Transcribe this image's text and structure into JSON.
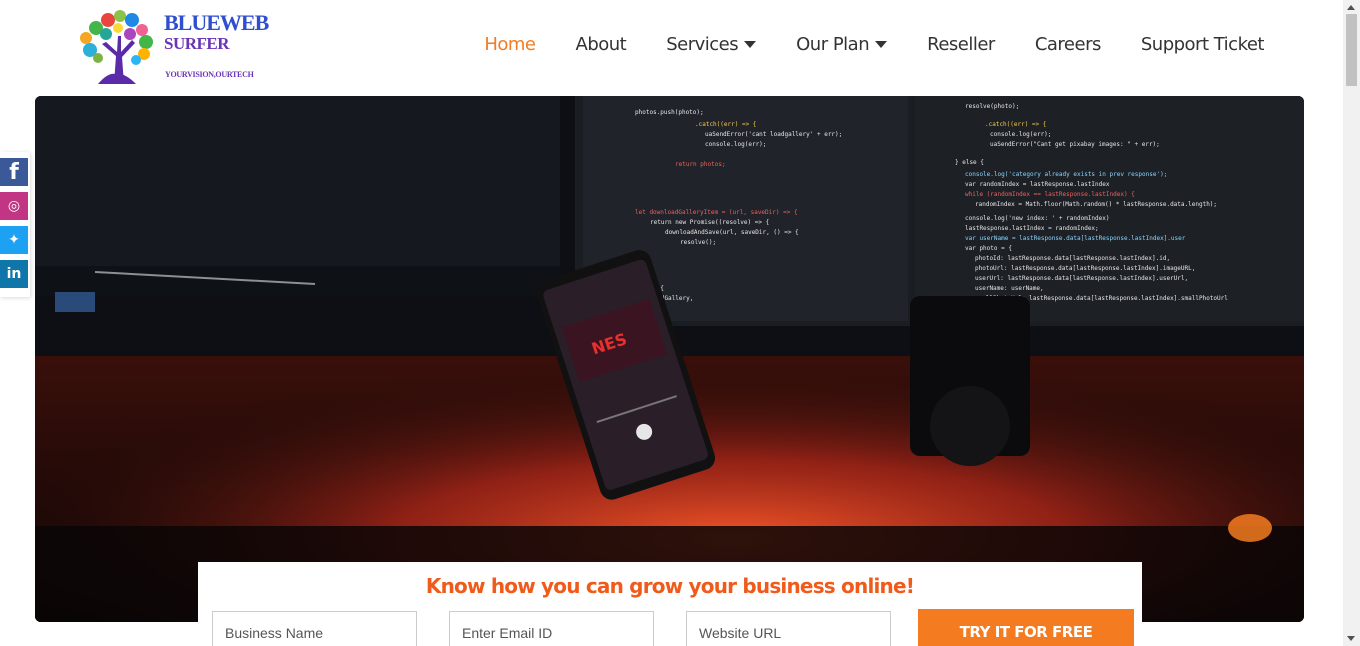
{
  "brand": {
    "line1": "BLUEWEB",
    "line2": "SURFER",
    "tagline": "YOURVISION,OURTECH"
  },
  "nav": {
    "items": [
      {
        "label": "Home",
        "active": true,
        "dropdown": false
      },
      {
        "label": "About",
        "active": false,
        "dropdown": false
      },
      {
        "label": "Services",
        "active": false,
        "dropdown": true
      },
      {
        "label": "Our Plan",
        "active": false,
        "dropdown": true
      },
      {
        "label": "Reseller",
        "active": false,
        "dropdown": false
      },
      {
        "label": "Careers",
        "active": false,
        "dropdown": false
      },
      {
        "label": "Support Ticket",
        "active": false,
        "dropdown": false
      }
    ]
  },
  "social": [
    "facebook-icon",
    "instagram-icon",
    "twitter-icon",
    "linkedin-icon"
  ],
  "hero": {
    "image": "desk setup with code monitors and smartphone, red backlight",
    "phone_logo": "NES"
  },
  "lead_form": {
    "title": "Know how you can grow your business online!",
    "business_placeholder": "Business Name",
    "email_placeholder": "Enter Email ID",
    "website_placeholder": "Website URL",
    "submit_label": "TRY IT FOR FREE"
  },
  "colors": {
    "accent": "#f47b20",
    "title": "#f05a1a",
    "logo_blue": "#2f4fcf",
    "logo_purple": "#6a34b8"
  }
}
